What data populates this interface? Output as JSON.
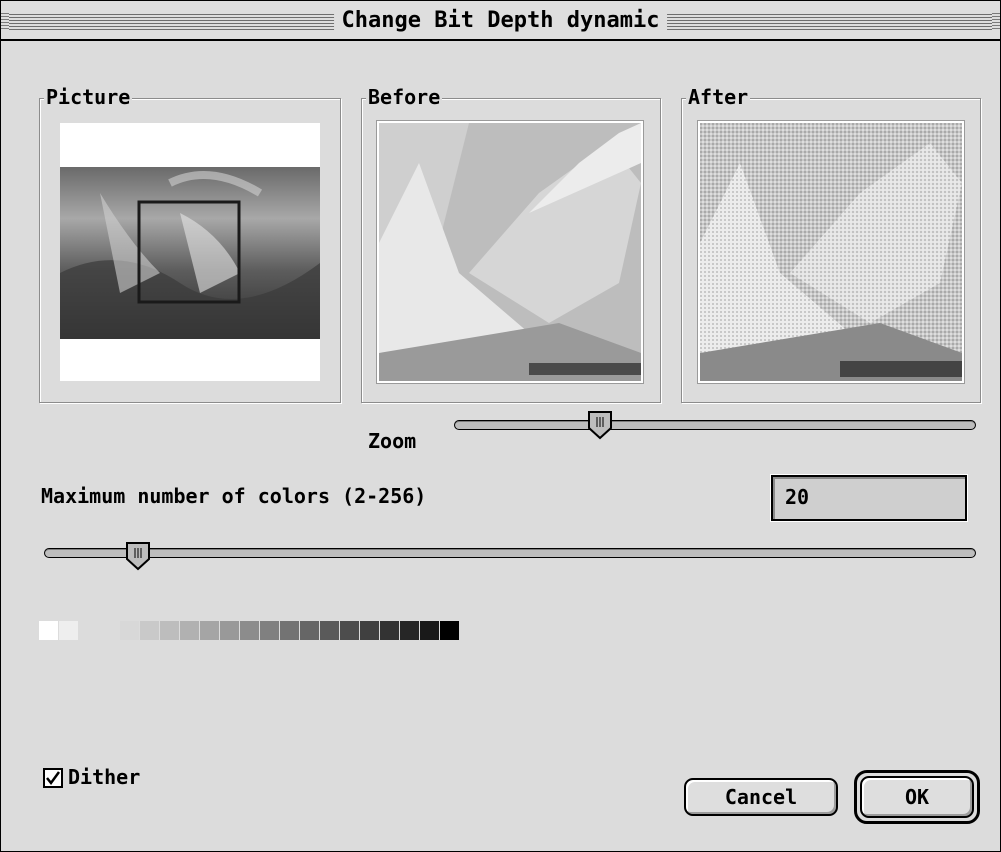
{
  "window": {
    "title": "Change Bit Depth dynamic"
  },
  "groups": {
    "picture": "Picture",
    "before": "Before",
    "after": "After"
  },
  "zoom": {
    "label": "Zoom",
    "value": 0.27
  },
  "colors": {
    "label": "Maximum number of colors (2-256)",
    "value": "20",
    "slider_value": 0.09
  },
  "palette": [
    "#ffffff",
    "#eeeeee",
    "#dcdcdc",
    "#d8d8d8",
    "#c9c9c9",
    "#bdbdbd",
    "#b1b1b1",
    "#a5a5a5",
    "#999999",
    "#8c8c8c",
    "#808080",
    "#737373",
    "#666666",
    "#5a5a5a",
    "#4d4d4d",
    "#404040",
    "#333333",
    "#262626",
    "#191919",
    "#000000"
  ],
  "dither": {
    "label": "Dither",
    "checked": true
  },
  "buttons": {
    "cancel": "Cancel",
    "ok": "OK"
  }
}
